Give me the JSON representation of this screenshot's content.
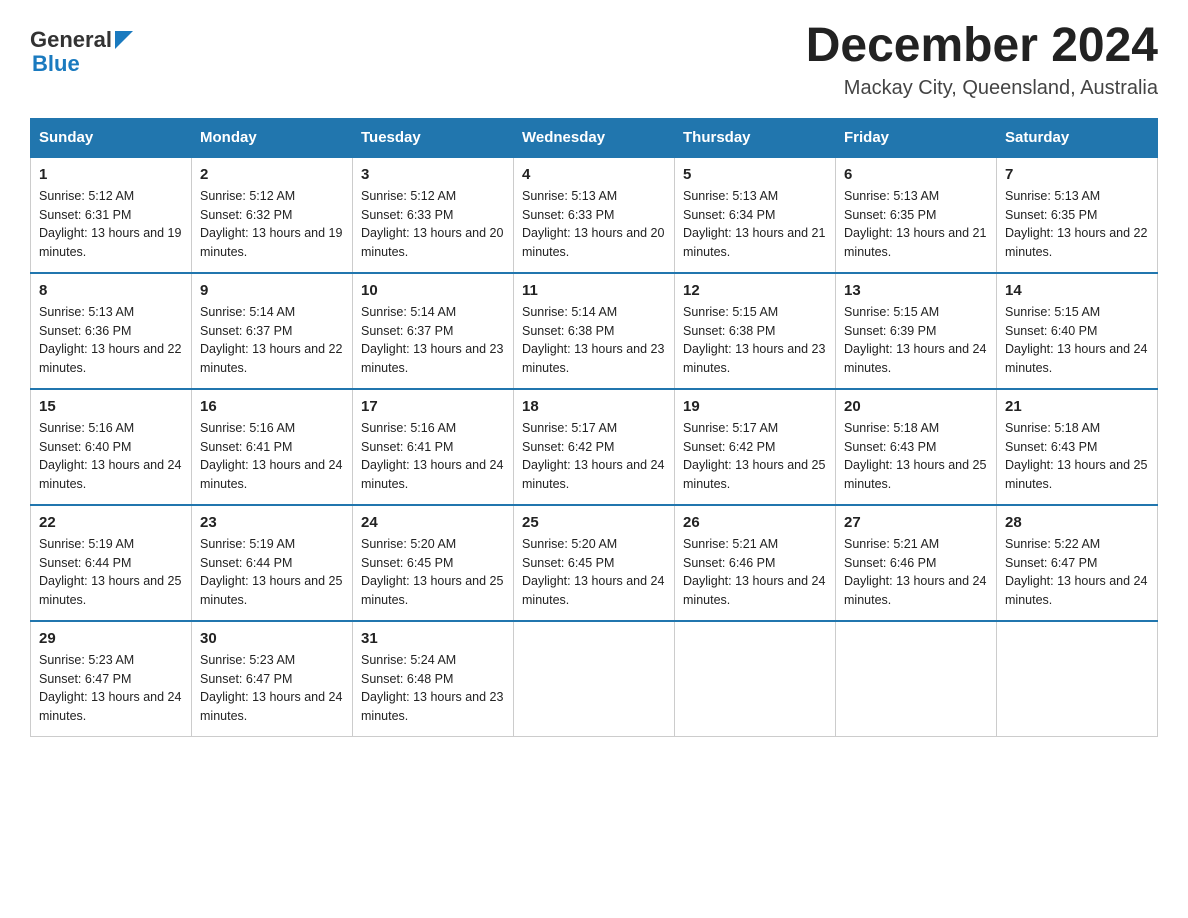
{
  "header": {
    "logo_general": "General",
    "logo_blue": "Blue",
    "month_title": "December 2024",
    "subtitle": "Mackay City, Queensland, Australia"
  },
  "days_of_week": [
    "Sunday",
    "Monday",
    "Tuesday",
    "Wednesday",
    "Thursday",
    "Friday",
    "Saturday"
  ],
  "weeks": [
    [
      {
        "day": "1",
        "sunrise": "5:12 AM",
        "sunset": "6:31 PM",
        "daylight": "13 hours and 19 minutes."
      },
      {
        "day": "2",
        "sunrise": "5:12 AM",
        "sunset": "6:32 PM",
        "daylight": "13 hours and 19 minutes."
      },
      {
        "day": "3",
        "sunrise": "5:12 AM",
        "sunset": "6:33 PM",
        "daylight": "13 hours and 20 minutes."
      },
      {
        "day": "4",
        "sunrise": "5:13 AM",
        "sunset": "6:33 PM",
        "daylight": "13 hours and 20 minutes."
      },
      {
        "day": "5",
        "sunrise": "5:13 AM",
        "sunset": "6:34 PM",
        "daylight": "13 hours and 21 minutes."
      },
      {
        "day": "6",
        "sunrise": "5:13 AM",
        "sunset": "6:35 PM",
        "daylight": "13 hours and 21 minutes."
      },
      {
        "day": "7",
        "sunrise": "5:13 AM",
        "sunset": "6:35 PM",
        "daylight": "13 hours and 22 minutes."
      }
    ],
    [
      {
        "day": "8",
        "sunrise": "5:13 AM",
        "sunset": "6:36 PM",
        "daylight": "13 hours and 22 minutes."
      },
      {
        "day": "9",
        "sunrise": "5:14 AM",
        "sunset": "6:37 PM",
        "daylight": "13 hours and 22 minutes."
      },
      {
        "day": "10",
        "sunrise": "5:14 AM",
        "sunset": "6:37 PM",
        "daylight": "13 hours and 23 minutes."
      },
      {
        "day": "11",
        "sunrise": "5:14 AM",
        "sunset": "6:38 PM",
        "daylight": "13 hours and 23 minutes."
      },
      {
        "day": "12",
        "sunrise": "5:15 AM",
        "sunset": "6:38 PM",
        "daylight": "13 hours and 23 minutes."
      },
      {
        "day": "13",
        "sunrise": "5:15 AM",
        "sunset": "6:39 PM",
        "daylight": "13 hours and 24 minutes."
      },
      {
        "day": "14",
        "sunrise": "5:15 AM",
        "sunset": "6:40 PM",
        "daylight": "13 hours and 24 minutes."
      }
    ],
    [
      {
        "day": "15",
        "sunrise": "5:16 AM",
        "sunset": "6:40 PM",
        "daylight": "13 hours and 24 minutes."
      },
      {
        "day": "16",
        "sunrise": "5:16 AM",
        "sunset": "6:41 PM",
        "daylight": "13 hours and 24 minutes."
      },
      {
        "day": "17",
        "sunrise": "5:16 AM",
        "sunset": "6:41 PM",
        "daylight": "13 hours and 24 minutes."
      },
      {
        "day": "18",
        "sunrise": "5:17 AM",
        "sunset": "6:42 PM",
        "daylight": "13 hours and 24 minutes."
      },
      {
        "day": "19",
        "sunrise": "5:17 AM",
        "sunset": "6:42 PM",
        "daylight": "13 hours and 25 minutes."
      },
      {
        "day": "20",
        "sunrise": "5:18 AM",
        "sunset": "6:43 PM",
        "daylight": "13 hours and 25 minutes."
      },
      {
        "day": "21",
        "sunrise": "5:18 AM",
        "sunset": "6:43 PM",
        "daylight": "13 hours and 25 minutes."
      }
    ],
    [
      {
        "day": "22",
        "sunrise": "5:19 AM",
        "sunset": "6:44 PM",
        "daylight": "13 hours and 25 minutes."
      },
      {
        "day": "23",
        "sunrise": "5:19 AM",
        "sunset": "6:44 PM",
        "daylight": "13 hours and 25 minutes."
      },
      {
        "day": "24",
        "sunrise": "5:20 AM",
        "sunset": "6:45 PM",
        "daylight": "13 hours and 25 minutes."
      },
      {
        "day": "25",
        "sunrise": "5:20 AM",
        "sunset": "6:45 PM",
        "daylight": "13 hours and 24 minutes."
      },
      {
        "day": "26",
        "sunrise": "5:21 AM",
        "sunset": "6:46 PM",
        "daylight": "13 hours and 24 minutes."
      },
      {
        "day": "27",
        "sunrise": "5:21 AM",
        "sunset": "6:46 PM",
        "daylight": "13 hours and 24 minutes."
      },
      {
        "day": "28",
        "sunrise": "5:22 AM",
        "sunset": "6:47 PM",
        "daylight": "13 hours and 24 minutes."
      }
    ],
    [
      {
        "day": "29",
        "sunrise": "5:23 AM",
        "sunset": "6:47 PM",
        "daylight": "13 hours and 24 minutes."
      },
      {
        "day": "30",
        "sunrise": "5:23 AM",
        "sunset": "6:47 PM",
        "daylight": "13 hours and 24 minutes."
      },
      {
        "day": "31",
        "sunrise": "5:24 AM",
        "sunset": "6:48 PM",
        "daylight": "13 hours and 23 minutes."
      },
      null,
      null,
      null,
      null
    ]
  ]
}
